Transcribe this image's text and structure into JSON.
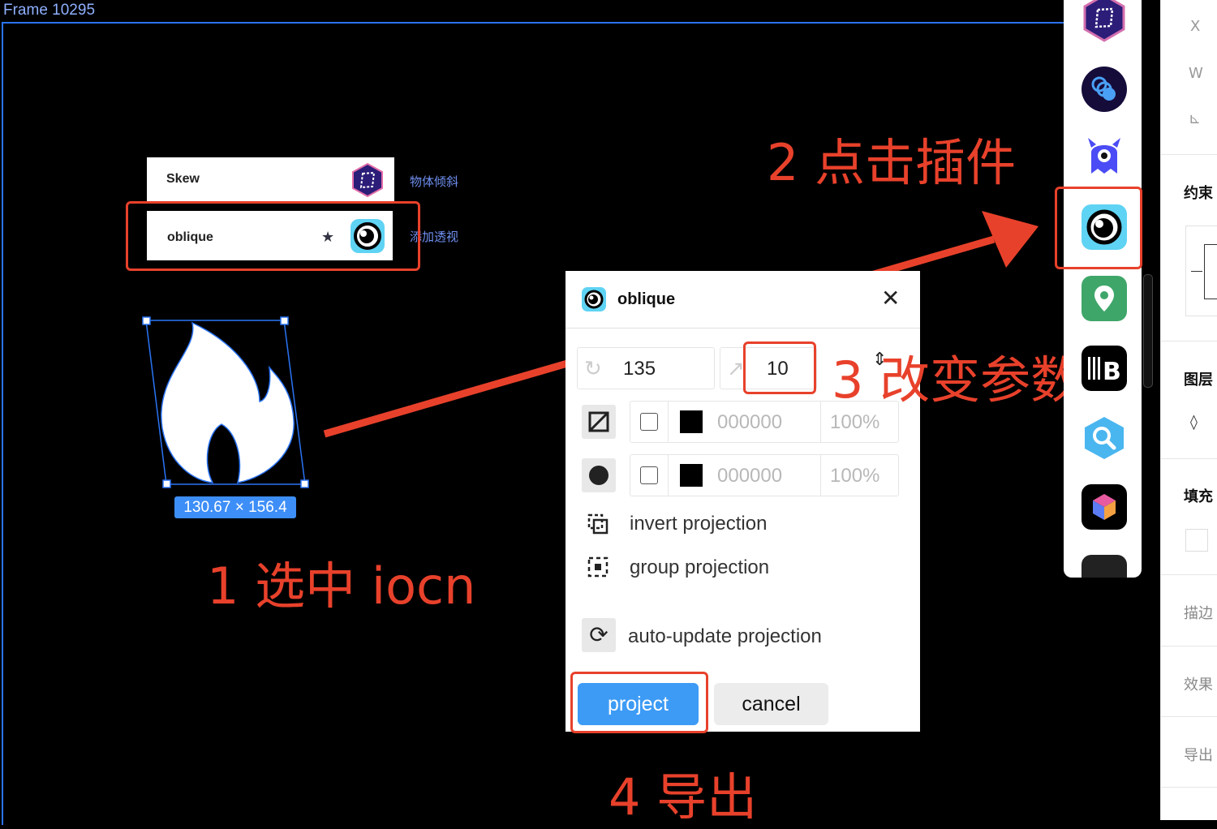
{
  "canvas": {
    "frame_label": "Frame 10295",
    "selection_size": "130.67 × 156.4"
  },
  "plugin_list": [
    {
      "label": "Skew",
      "note": "物体倾斜",
      "icon": "skew-plugin-icon"
    },
    {
      "label": "oblique",
      "note": "添加透视",
      "icon": "oblique-plugin-icon",
      "starred": true
    }
  ],
  "annotations": {
    "step1": "1 选中 iocn",
    "step2": "2 点击插件",
    "step3": "3 改变参数",
    "step4": "4 导出"
  },
  "dialog": {
    "title": "oblique",
    "rotation_value": "135",
    "skew_value": "10",
    "fill_row": {
      "color": "000000",
      "opacity": "100%"
    },
    "stroke_row": {
      "color": "000000",
      "opacity": "100%"
    },
    "options": [
      "invert projection",
      "group projection",
      "auto-update projection"
    ],
    "project_label": "project",
    "cancel_label": "cancel"
  },
  "plugin_bar": {
    "icons": [
      "skew-hex-icon",
      "blue-circles-icon",
      "blue-monster-icon",
      "oblique-eye-icon",
      "map-pin-icon",
      "barcode-b-icon",
      "search-hex-icon",
      "cube-icon"
    ]
  },
  "right_panel": {
    "x_label": "X",
    "w_label": "W",
    "angle_label": "⊾",
    "constraints": "约束",
    "layers": "图层",
    "fill": "填充",
    "stroke": "描边",
    "effects": "效果",
    "export": "导出"
  },
  "colors": {
    "annotation_red": "#e8412b",
    "selection_blue": "#2a74f5",
    "project_button": "#3d9bf5",
    "canvas_bg": "#000000"
  }
}
